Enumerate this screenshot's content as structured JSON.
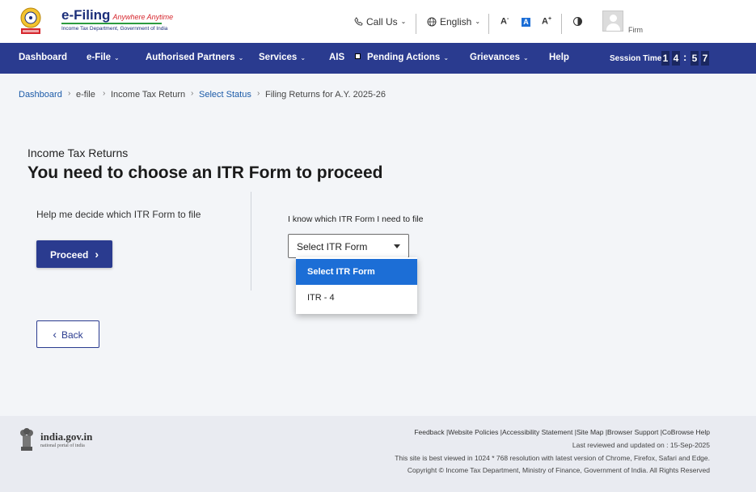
{
  "header": {
    "brand_name": "e-Filing",
    "brand_tag": "Anywhere Anytime",
    "brand_sub": "Income Tax Department, Government of India",
    "call_label": "Call Us",
    "language_label": "English",
    "font_decrease": "A",
    "font_default": "A",
    "font_increase": "A",
    "user_role": "Firm"
  },
  "nav": {
    "items": [
      "Dashboard",
      "e-File",
      "Authorised Partners",
      "Services",
      "AIS",
      "Pending Actions",
      "Grievances",
      "Help"
    ],
    "session_label": "Session Time",
    "session_digits": [
      "1",
      "4",
      "5",
      "7"
    ]
  },
  "breadcrumb": [
    "Dashboard",
    "e-file",
    "Income Tax Return",
    "Select Status",
    "Filing Returns for A.Y. 2025-26"
  ],
  "main": {
    "eyebrow": "Income Tax Returns",
    "heading": "You need to choose an ITR Form to proceed",
    "help_text": "Help me decide which ITR Form to file",
    "proceed_label": "Proceed",
    "know_label": "I know which ITR Form I need to file",
    "select_value": "Select ITR Form",
    "options": [
      "Select ITR Form",
      "ITR - 4"
    ],
    "back_label": "Back"
  },
  "footer": {
    "gov_name": "india.gov.in",
    "gov_sub": "national portal of india",
    "links": "Feedback |Website Policies |Accessibility Statement |Site Map |Browser Support |CoBrowse Help",
    "reviewed": "Last reviewed and updated on : 15-Sep-2025",
    "best_viewed": "This site is best viewed in 1024 * 768 resolution with latest version of Chrome, Firefox, Safari and Edge.",
    "copyright": "Copyright © Income Tax Department, Ministry of Finance, Government of India. All Rights Reserved"
  },
  "colors": {
    "nav_bg": "#2a3b8f",
    "accent_blue": "#1c6ed6",
    "link_blue": "#1c5ba8",
    "brand_red": "#d6262d",
    "brand_green": "#2c9b3f"
  }
}
